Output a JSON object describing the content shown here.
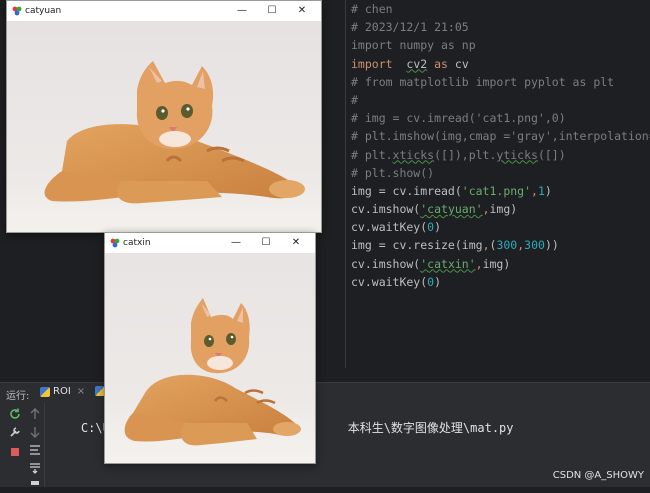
{
  "editor": {
    "lines": [
      [
        {
          "t": "# chen",
          "c": "cm"
        }
      ],
      [
        {
          "t": "# 2023/12/1 21:05",
          "c": "cm"
        }
      ],
      [
        {
          "t": "import numpy as np",
          "c": "cm"
        }
      ],
      [
        {
          "t": "import",
          "c": "kw"
        },
        {
          "t": "  ",
          "c": ""
        },
        {
          "t": "cv2",
          "c": "squig"
        },
        {
          "t": " as ",
          "c": "kw"
        },
        {
          "t": "cv",
          "c": ""
        }
      ],
      [
        {
          "t": "# from matplotlib import pyplot as plt",
          "c": "cm"
        }
      ],
      [
        {
          "t": "#",
          "c": "cm"
        }
      ],
      [
        {
          "t": "# img = cv.imread('cat1.png',0)",
          "c": "cm"
        }
      ],
      [
        {
          "t": "# plt.imshow(img,cmap ='gray',interpolation= '",
          "c": "cm"
        }
      ],
      [
        {
          "t": "# plt.",
          "c": "cm"
        },
        {
          "t": "xticks",
          "c": "cm squig"
        },
        {
          "t": "([]),plt.",
          "c": "cm"
        },
        {
          "t": "yticks",
          "c": "cm squig"
        },
        {
          "t": "([])",
          "c": "cm"
        }
      ],
      [
        {
          "t": "# plt.show()",
          "c": "cm"
        }
      ],
      [
        {
          "t": "img = cv.imread(",
          "c": ""
        },
        {
          "t": "'cat1.png'",
          "c": "str"
        },
        {
          "t": ",",
          "c": "warn"
        },
        {
          "t": "1",
          "c": "num"
        },
        {
          "t": ")",
          "c": ""
        }
      ],
      [
        {
          "t": "cv.imshow(",
          "c": ""
        },
        {
          "t": "'catyuan'",
          "c": "str squig"
        },
        {
          "t": ",",
          "c": "warn"
        },
        {
          "t": "img)",
          "c": ""
        }
      ],
      [
        {
          "t": "cv.waitKey(",
          "c": ""
        },
        {
          "t": "0",
          "c": "num"
        },
        {
          "t": ")",
          "c": ""
        }
      ],
      [
        {
          "t": "img = cv.resize(img",
          "c": ""
        },
        {
          "t": ",",
          "c": "warn"
        },
        {
          "t": "(",
          "c": ""
        },
        {
          "t": "300",
          "c": "num"
        },
        {
          "t": ",",
          "c": "warn"
        },
        {
          "t": "300",
          "c": "num"
        },
        {
          "t": "))",
          "c": ""
        }
      ],
      [
        {
          "t": "cv.imshow(",
          "c": ""
        },
        {
          "t": "'catxin'",
          "c": "str squig"
        },
        {
          "t": ",",
          "c": "warn"
        },
        {
          "t": "img)",
          "c": ""
        }
      ],
      [
        {
          "t": "cv.waitKey(",
          "c": ""
        },
        {
          "t": "0",
          "c": "num"
        },
        {
          "t": ")",
          "c": ""
        }
      ]
    ]
  },
  "run_panel": {
    "label": "运行:",
    "tab_name": "ROI",
    "close_glyph": "×",
    "console_path_prefix": "C:\\Users",
    "console_path_suffix": "本科生\\数字图像处理\\mat.py"
  },
  "watermark": "CSDN @A_SHOWY",
  "windows": {
    "catyuan": {
      "title": "catyuan",
      "minimize": "—",
      "maximize": "☐",
      "close": "✕"
    },
    "catxin": {
      "title": "catxin",
      "minimize": "—",
      "maximize": "☐",
      "close": "✕"
    }
  },
  "colors": {
    "editor_bg": "#1e1f22",
    "comment": "#7a7e85",
    "keyword": "#cf8e6d",
    "string": "#6aab73",
    "number": "#2aacb8"
  }
}
